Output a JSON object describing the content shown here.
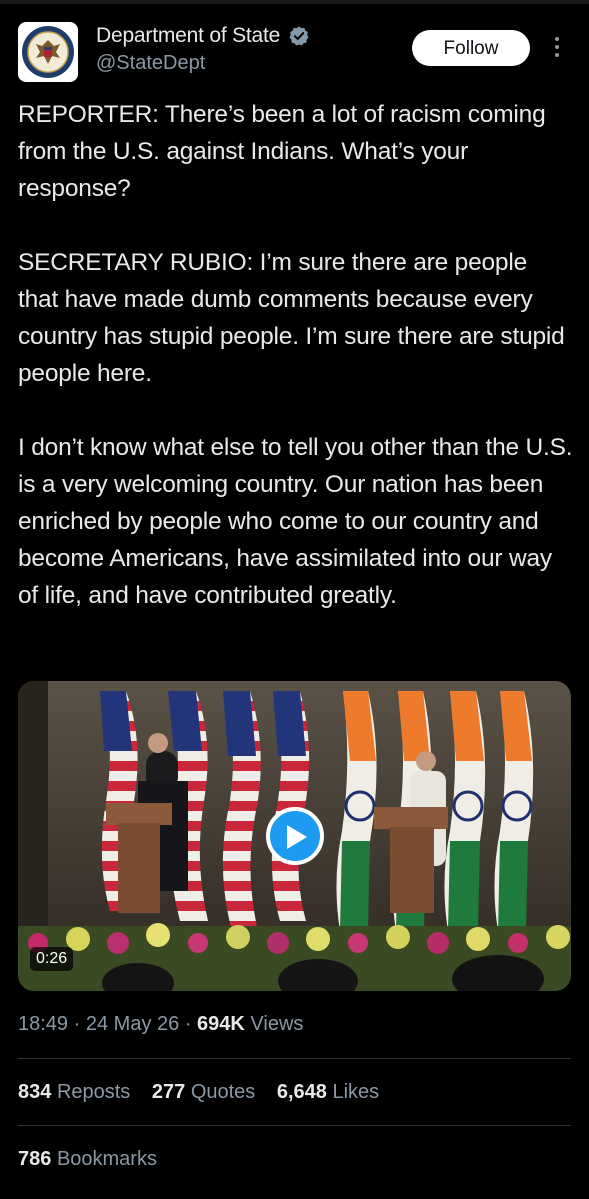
{
  "account": {
    "display_name": "Department of State",
    "handle": "@StateDept",
    "avatar_icon": "department-of-state-seal-icon",
    "verified_icon": "verified-badge-icon",
    "verified_color": "#829aab"
  },
  "actions": {
    "follow_label": "Follow",
    "more_icon": "more-options-icon"
  },
  "tweet": {
    "paragraphs": [
      "REPORTER: There’s been a lot of racism coming from the U.S. against Indians. What’s your response?",
      "SECRETARY RUBIO: I’m sure there are people that have made dumb comments because every country has stupid people. I’m sure there are stupid people here.",
      "I don’t know what else to tell you other than the U.S. is a very welcoming country. Our nation has been enriched by people who come to our country and become Americans, have assimilated into our way of life, and have contributed greatly."
    ]
  },
  "media": {
    "type": "video",
    "duration": "0:26",
    "play_icon": "play-icon",
    "accent_color": "#1d9bf0"
  },
  "meta": {
    "time": "18:49",
    "separator": "·",
    "date": "24 May 26",
    "views_count": "694K",
    "views_label": "Views"
  },
  "stats": {
    "reposts_count": "834",
    "reposts_label": "Reposts",
    "quotes_count": "277",
    "quotes_label": "Quotes",
    "likes_count": "6,648",
    "likes_label": "Likes",
    "bookmarks_count": "786",
    "bookmarks_label": "Bookmarks"
  }
}
